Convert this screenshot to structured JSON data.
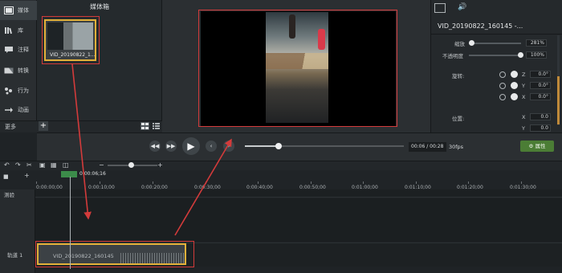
{
  "sidebar": {
    "items": [
      {
        "label": "媒体",
        "icon": "media-icon"
      },
      {
        "label": "库",
        "icon": "library-icon"
      },
      {
        "label": "注释",
        "icon": "annotation-icon"
      },
      {
        "label": "转换",
        "icon": "transition-icon"
      },
      {
        "label": "行为",
        "icon": "behavior-icon"
      },
      {
        "label": "动画",
        "icon": "animation-icon"
      }
    ],
    "more_label": "更多",
    "add_label": "+"
  },
  "media_bin": {
    "title": "媒体箱",
    "items": [
      {
        "label": "VID_20190822_1..."
      }
    ]
  },
  "properties": {
    "clip_title": "VID_20190822_160145 -...",
    "scale_label": "缩放",
    "scale_value": "281%",
    "opacity_label": "不透明度",
    "opacity_value": "100%",
    "rotation_label": "旋转:",
    "rotation": [
      {
        "axis": "Z",
        "value": "0.0°"
      },
      {
        "axis": "Y",
        "value": "0.0°"
      },
      {
        "axis": "X",
        "value": "0.0°"
      }
    ],
    "position_label": "位置:",
    "position": [
      {
        "axis": "X",
        "value": "0.0"
      },
      {
        "axis": "Y",
        "value": "0.0"
      }
    ],
    "button_label": "属性"
  },
  "transport": {
    "time": "00:06 / 00:28",
    "fps": "30fps",
    "progress": 0.21
  },
  "timeline": {
    "playhead_time": "0:00:06;16",
    "ticks": [
      "0:00:00;00",
      "0:00:10;00",
      "0:00:20;00",
      "0:00:30;00",
      "0:00:40;00",
      "0:00:50;00",
      "0:01:00;00",
      "0:01:10;00",
      "0:01:20;00",
      "0:01:30;00"
    ],
    "marker_label": "测验",
    "track_label": "轨道 1",
    "clip_label": "VID_20190822_160145"
  },
  "colors": {
    "highlight": "#d33b3b",
    "selection": "#e3b13a",
    "accent_green": "#4b7d35"
  }
}
